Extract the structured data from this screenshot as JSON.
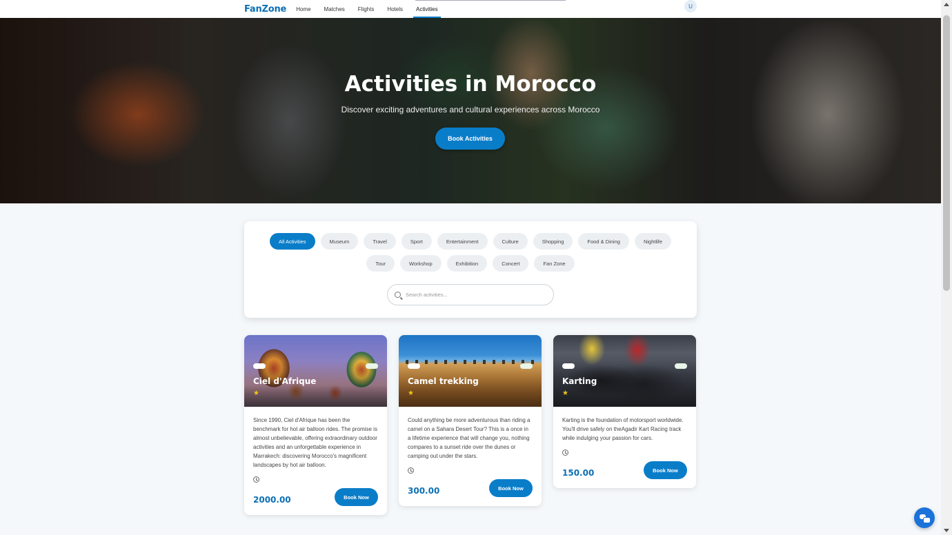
{
  "nav": {
    "brand": "FanZone",
    "links": [
      {
        "label": "Home"
      },
      {
        "label": "Matches"
      },
      {
        "label": "Flights"
      },
      {
        "label": "Hotels"
      },
      {
        "label": "Activities",
        "active": true
      }
    ],
    "avatar_initial": "U"
  },
  "hero": {
    "title": "Activities in Morocco",
    "subtitle": "Discover exciting adventures and cultural experiences across Morocco",
    "cta_label": "Book Activities"
  },
  "filters": {
    "categories": [
      "All Activities",
      "Museum",
      "Travel",
      "Sport",
      "Entertainment",
      "Culture",
      "Shopping",
      "Food & Dining",
      "Nightlife",
      "Tour",
      "Workshop",
      "Exhibition",
      "Concert",
      "Fan Zone"
    ],
    "active_category": "All Activities",
    "search_placeholder": "Search activities...",
    "search_value": ""
  },
  "activities": [
    {
      "title": "Ciel d'Afrique",
      "rating_icon": "star-icon",
      "description": "Since 1990, Ciel d'Afrique has been the benchmark for hot air balloon rides. The promise is almost unbelievable, offering extraordinary outdoor activities and an unforgettable experience in Marrakech: discovering Morocco's magnificent landscapes by hot air balloon.",
      "price": "2000.00",
      "book_label": "Book Now"
    },
    {
      "title": "Camel trekking",
      "rating_icon": "star-icon",
      "description": "Could anything be more adventurous than riding a camel on a Sahara Desert Tour? This is a once in a lifetime experience that will change you, nothing compares to a sunset ride over the dunes or camping out under the stars.",
      "price": "300.00",
      "book_label": "Book Now"
    },
    {
      "title": "Karting",
      "rating_icon": "star-icon",
      "description": "Karting is the foundation of motorsport worldwide. You'll drive safely on theAgadir Kart Racing track while indulging your passion for cars.",
      "price": "150.00",
      "book_label": "Book Now"
    }
  ],
  "colors": {
    "primary": "#0a7dc9",
    "brand": "#0c6fb5",
    "star": "#f5c518",
    "chat_fab": "#1a73d9"
  }
}
